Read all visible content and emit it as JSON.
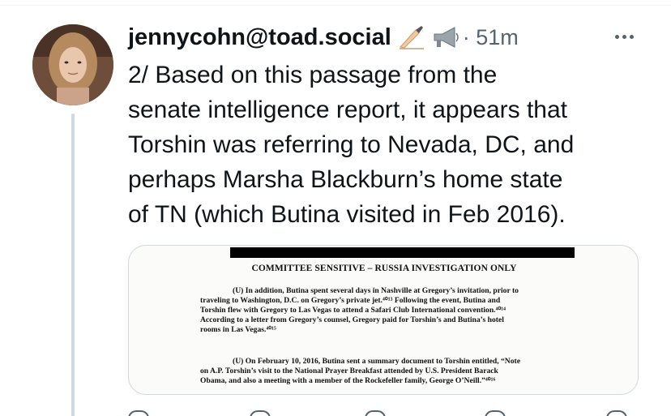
{
  "post": {
    "username": "jennycohn@toad.social",
    "badges": [
      "writing-hand-icon",
      "megaphone-icon"
    ],
    "timestamp": "· 51m",
    "text_lines": [
      "2/ Based on this passage from the",
      "senate intelligence report, it appears that",
      "Torshin was referring to Nevada, DC, and",
      "perhaps Marsha Blackburn’s home state",
      "of TN (which Butina visited in Feb 2016)."
    ]
  },
  "document": {
    "header": "COMMITTEE SENSITIVE – RUSSIA INVESTIGATION ONLY",
    "paragraph1": [
      "(U) In addition, Butina spent several days in Nashville at Gregory’s invitation, prior to",
      "traveling to Washington, D.C. on Gregory’s private jet.⁴⁰¹³ Following the event, Butina and",
      "Torshin flew with Gregory to Las Vegas to attend a Safari Club International convention.⁴⁰¹⁴",
      "According to a letter from Gregory’s counsel, Gregory paid for Torshin’s and Butina’s hotel",
      "rooms in Las Vegas.⁴⁰¹⁵"
    ],
    "paragraph2": [
      "(U) On February 10, 2016, Butina sent a summary document to Torshin entitled, “Note",
      "on A.P. Torshin’s visit to the National Prayer Breakfast attended by U.S. President Barack",
      "Obama, and also a meeting with a member of the Rockefeller family, George O’Neill.”⁴⁰¹⁶"
    ]
  },
  "colors": {
    "text": "#0f1419",
    "secondary": "#536471",
    "border": "#cfd9de"
  }
}
